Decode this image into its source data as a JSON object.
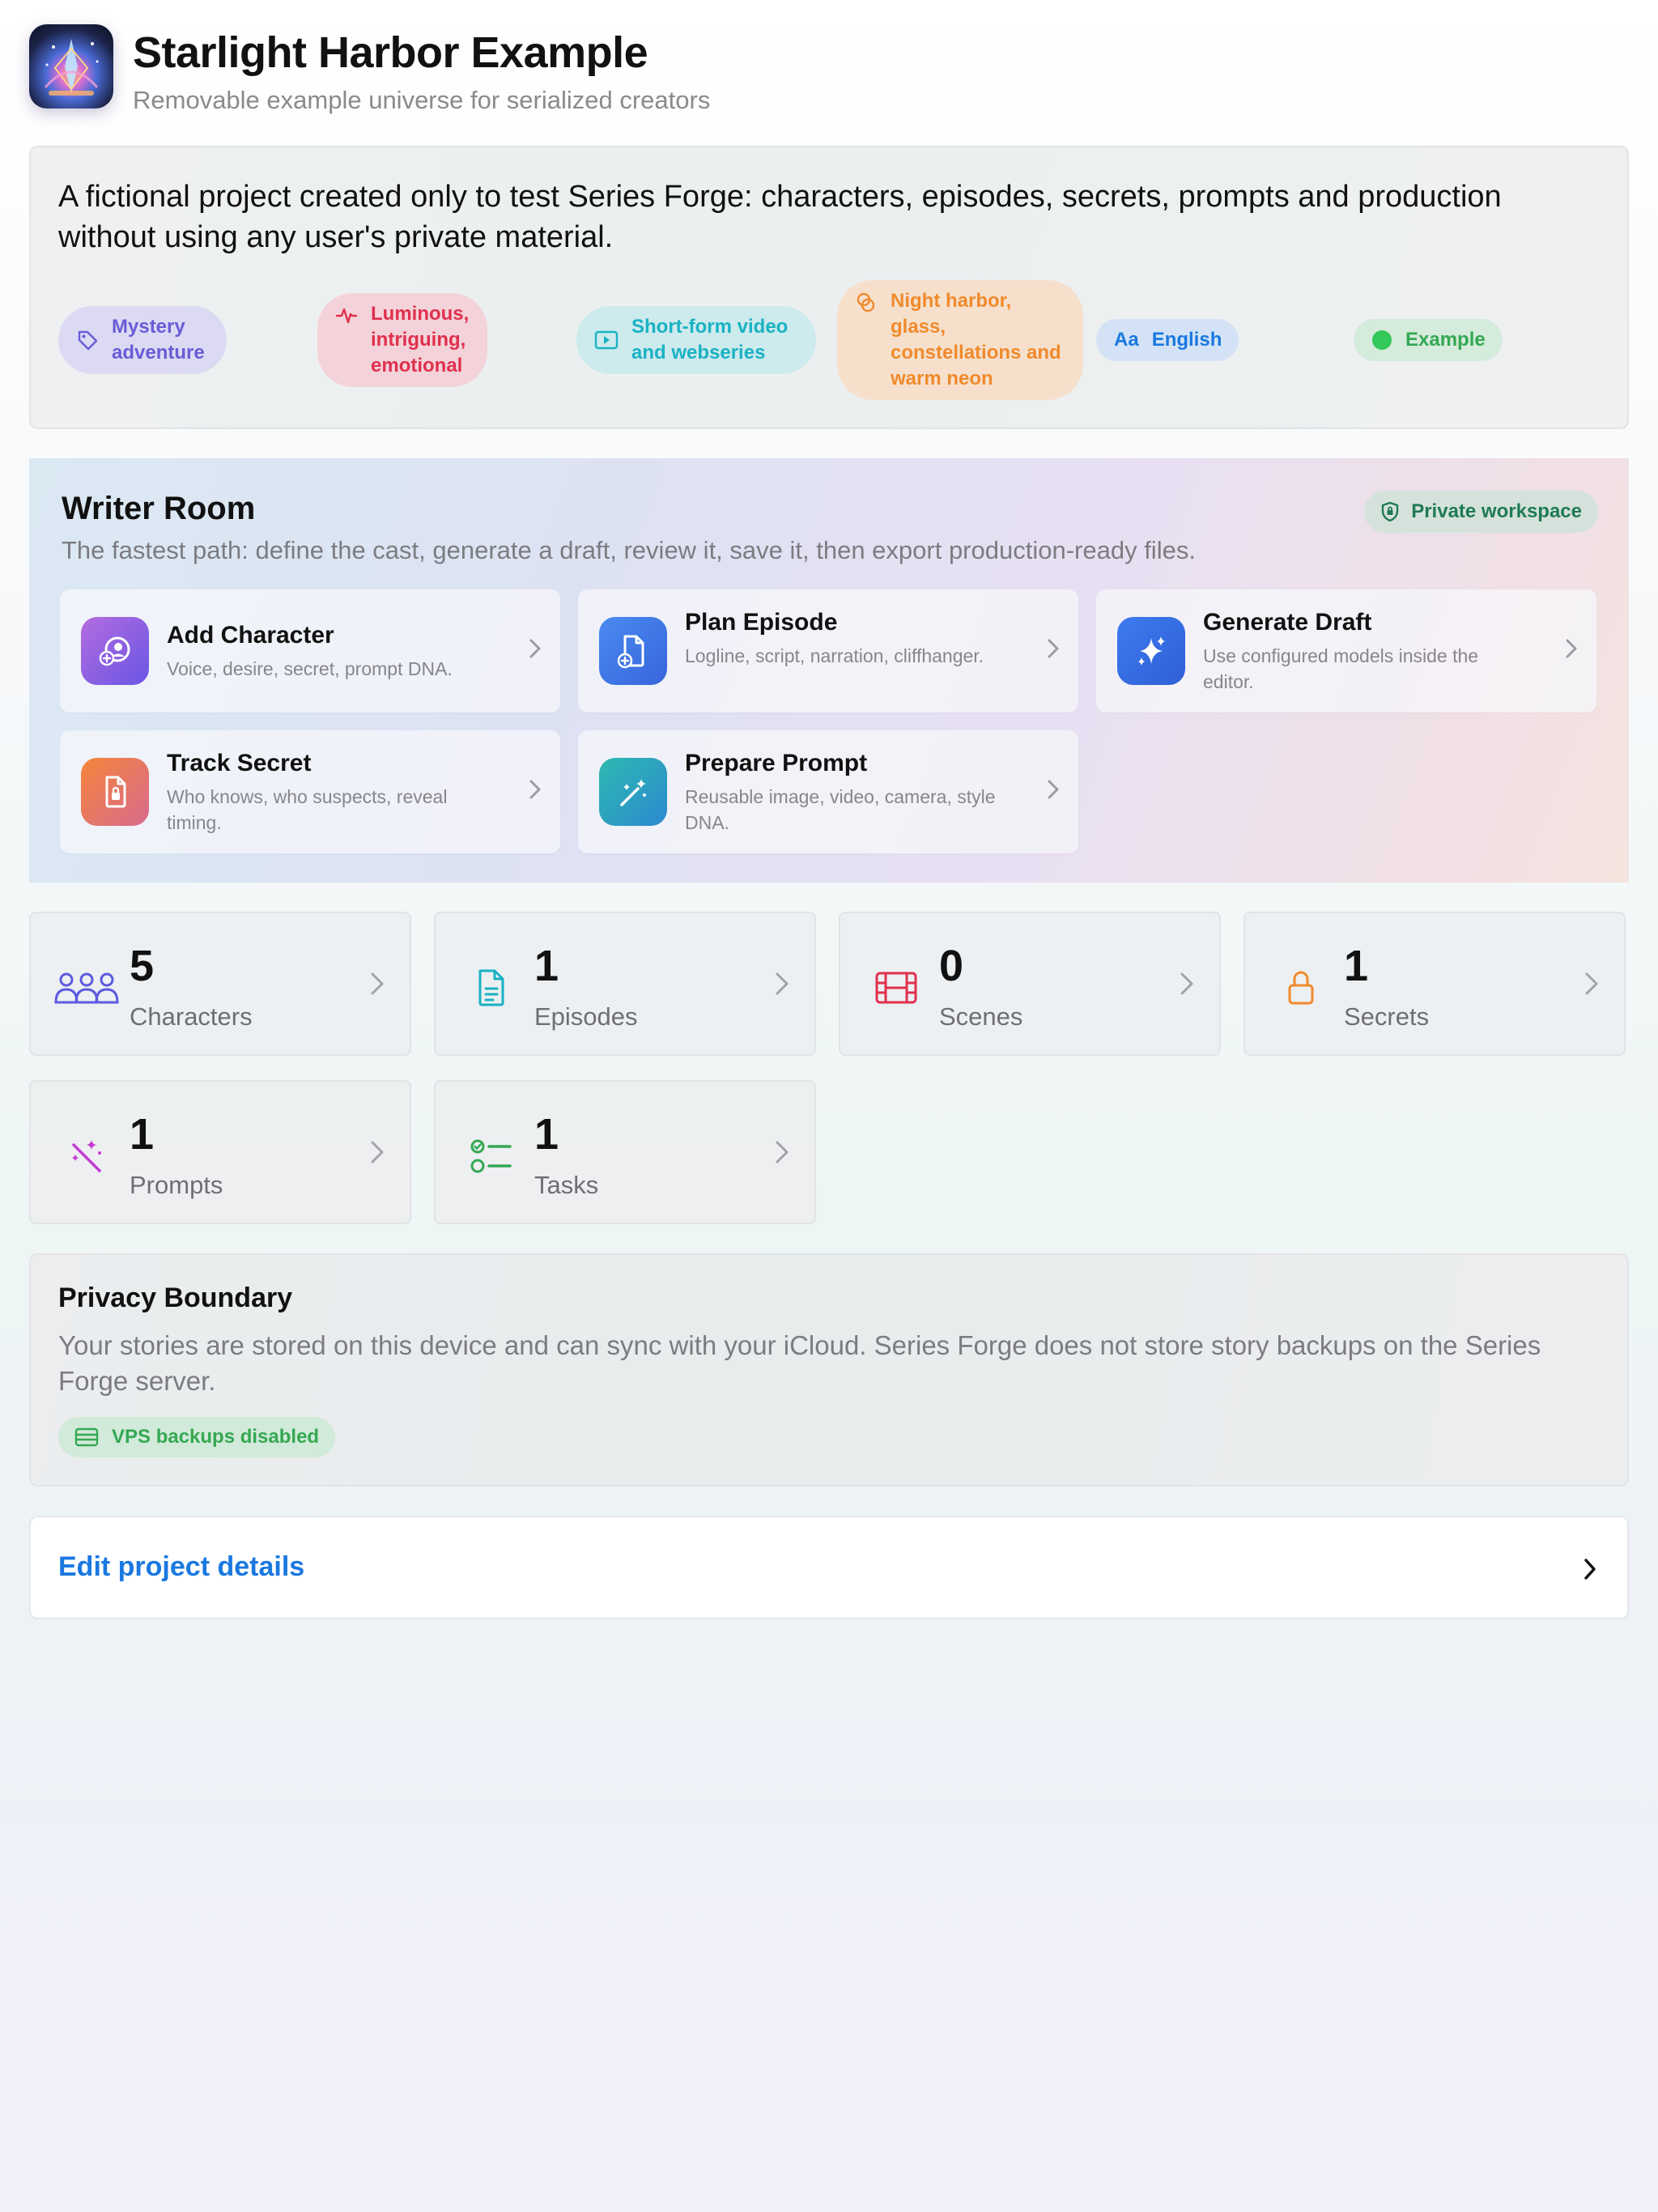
{
  "project": {
    "title": "Starlight Harbor Example",
    "subtitle": "Removable example universe for serialized creators",
    "icon": "app-icon-starlight-harbor",
    "description": "A fictional project created only to test Series Forge: characters, episodes, secrets, prompts and production without using any user's private material."
  },
  "tags": [
    {
      "label": "Mystery adventure",
      "icon": "tag-icon",
      "color": "#6b5bd6",
      "bg": "#dcdaf3"
    },
    {
      "label": "Luminous, intriguing, emotional",
      "icon": "waveform-icon",
      "color": "#e0304e",
      "bg": "#f3d3d9"
    },
    {
      "label": "Short-form video and webseries",
      "icon": "play-rectangle-icon",
      "color": "#19b2c4",
      "bg": "#cdeaed"
    },
    {
      "label": "Night harbor, glass, constellations and warm neon",
      "icon": "palette-icon",
      "color": "#f08a2c",
      "bg": "#f6e0cc"
    },
    {
      "label": "English",
      "icon_text": "Aa",
      "icon": "language-icon",
      "color": "#1a78e0",
      "bg": "#d3e3f5"
    },
    {
      "label": "Example",
      "icon": "status-dot-icon",
      "color": "#34a853",
      "bg": "#d5ebdb"
    }
  ],
  "writer_room": {
    "title": "Writer Room",
    "subtitle": "The fastest path: define the cast, generate a draft, review it, save it, then export production-ready files.",
    "badge": "Private workspace",
    "actions": [
      {
        "title": "Add Character",
        "desc": "Voice, desire, secret, prompt DNA.",
        "icon": "add-character-icon"
      },
      {
        "title": "Plan Episode",
        "desc": "Logline, script, narration, cliffhanger.",
        "icon": "plan-episode-icon"
      },
      {
        "title": "Generate Draft",
        "desc": "Use configured models inside the editor.",
        "icon": "sparkles-icon"
      },
      {
        "title": "Track Secret",
        "desc": "Who knows, who suspects, reveal timing.",
        "icon": "locked-document-icon"
      },
      {
        "title": "Prepare Prompt",
        "desc": "Reusable image, video, camera, style DNA.",
        "icon": "magic-wand-icon"
      }
    ]
  },
  "stats": [
    {
      "value": "5",
      "label": "Characters",
      "icon": "people-icon",
      "color": "#5b5be0"
    },
    {
      "value": "1",
      "label": "Episodes",
      "icon": "document-icon",
      "color": "#19b2c4"
    },
    {
      "value": "0",
      "label": "Scenes",
      "icon": "film-icon",
      "color": "#e0304e"
    },
    {
      "value": "1",
      "label": "Secrets",
      "icon": "lock-icon",
      "color": "#f08a2c"
    },
    {
      "value": "1",
      "label": "Prompts",
      "icon": "magic-wand-icon",
      "color": "#c43ad6"
    },
    {
      "value": "1",
      "label": "Tasks",
      "icon": "checklist-icon",
      "color": "#34a853"
    }
  ],
  "privacy": {
    "title": "Privacy Boundary",
    "desc": "Your stories are stored on this device and can sync with your iCloud. Series Forge does not store story backups on the Series Forge server.",
    "badge": "VPS backups disabled"
  },
  "edit": {
    "label": "Edit project details"
  }
}
